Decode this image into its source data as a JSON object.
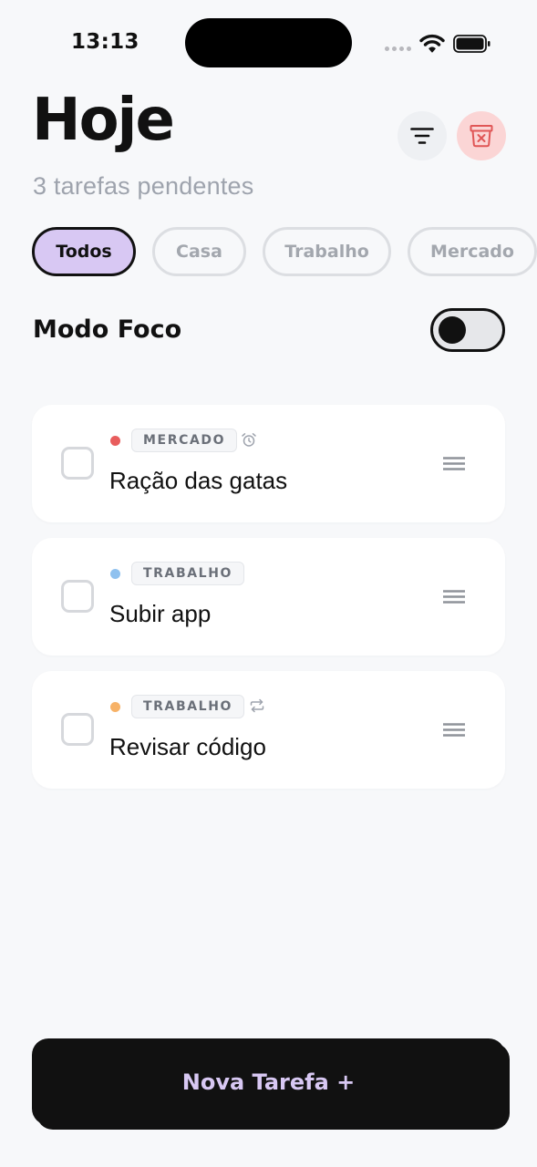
{
  "status_bar": {
    "time": "13:13",
    "icons": [
      "cellular-signal-icon",
      "wifi-icon",
      "battery-icon"
    ]
  },
  "header": {
    "title": "Hoje",
    "subtitle": "3 tarefas pendentes",
    "actions": [
      {
        "icon": "filter-icon",
        "background": "#eef0f3"
      },
      {
        "icon": "clear-tasks-icon",
        "background": "#fbd5d5",
        "color": "#e05656"
      }
    ]
  },
  "categories": {
    "items": [
      "Todos",
      "Casa",
      "Trabalho",
      "Mercado"
    ],
    "selected": "Todos",
    "active_color": "#d8c8f3"
  },
  "focus_mode": {
    "label": "Modo Foco",
    "enabled": false
  },
  "tasks": [
    {
      "title": "Ração das gatas",
      "tag": "MERCADO",
      "dot_color": "#e85d5d",
      "extra_icon": "alarm-icon",
      "done": false
    },
    {
      "title": "Subir app",
      "tag": "TRABALHO",
      "dot_color": "#8fc1ef",
      "extra_icon": null,
      "done": false
    },
    {
      "title": "Revisar código",
      "tag": "TRABALHO",
      "dot_color": "#f7b267",
      "extra_icon": "repeat-icon",
      "done": false
    }
  ],
  "new_task_button": {
    "label": "Nova Tarefa +"
  }
}
